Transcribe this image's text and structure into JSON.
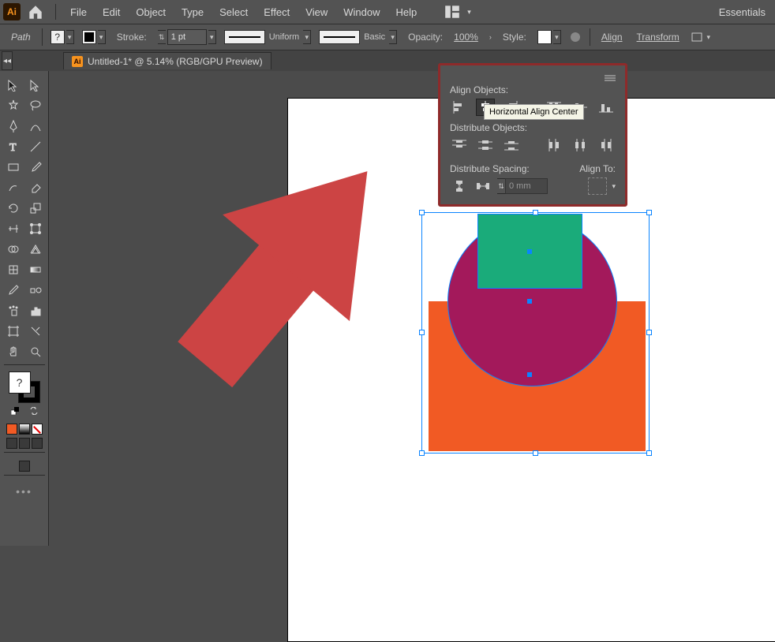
{
  "app": {
    "logo": "Ai",
    "workspace_label": "Essentials"
  },
  "menu": {
    "file": "File",
    "edit": "Edit",
    "object": "Object",
    "type": "Type",
    "select": "Select",
    "effect": "Effect",
    "view": "View",
    "window": "Window",
    "help": "Help"
  },
  "controlbar": {
    "mode": "Path",
    "fill_value": "?",
    "stroke": "Stroke:",
    "stroke_weight": "1 pt",
    "uniform": "Uniform",
    "basic": "Basic",
    "opacity": "Opacity:",
    "opacity_value": "100%",
    "style": "Style:",
    "align": "Align",
    "transform": "Transform"
  },
  "tab": {
    "title": "Untitled-1* @ 5.14% (RGB/GPU Preview)"
  },
  "toolbox": {
    "tools": [
      "selection-tool",
      "direct-selection-tool",
      "magic-wand-tool",
      "lasso-tool",
      "pen-tool",
      "curvature-tool",
      "type-tool",
      "line-segment-tool",
      "rectangle-tool",
      "paintbrush-tool",
      "shaper-tool",
      "eraser-tool",
      "rotate-tool",
      "scale-tool",
      "width-tool",
      "free-transform-tool",
      "shape-builder-tool",
      "perspective-grid-tool",
      "mesh-tool",
      "gradient-tool",
      "eyedropper-tool",
      "blend-tool",
      "symbol-sprayer-tool",
      "column-graph-tool",
      "artboard-tool",
      "slice-tool",
      "hand-tool",
      "zoom-tool"
    ],
    "fill_placeholder": "?",
    "more": "…"
  },
  "align_panel": {
    "align_objects": "Align Objects:",
    "distribute_objects": "Distribute Objects:",
    "distribute_spacing": "Distribute Spacing:",
    "align_to": "Align To:",
    "spacing_value": "0 mm",
    "tooltip": "Horizontal Align Center"
  }
}
